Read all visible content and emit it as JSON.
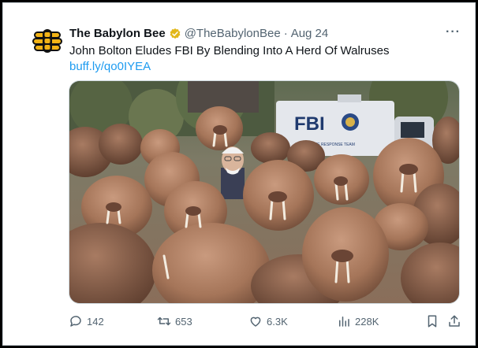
{
  "tweet": {
    "display_name": "The Babylon Bee",
    "handle": "@TheBabylonBee",
    "separator": "·",
    "date": "Aug 24",
    "text": "John Bolton Eludes FBI By Blending Into A Herd Of Walruses",
    "link": "buff.ly/qo0IYEA",
    "more_label": "···"
  },
  "media": {
    "truck_label": "FBI",
    "truck_sublabel": "EVIDENCE RESPONSE TEAM"
  },
  "actions": {
    "replies": "142",
    "retweets": "653",
    "likes": "6.3K",
    "views": "228K"
  },
  "colors": {
    "link": "#1d9bf0",
    "secondary_text": "#536471",
    "verified": "#e2b719",
    "logo": "#f2b316"
  },
  "icons": [
    "bee-logo-icon",
    "verified-badge-icon",
    "more-icon",
    "reply-icon",
    "retweet-icon",
    "like-icon",
    "views-icon",
    "bookmark-icon",
    "share-icon"
  ]
}
